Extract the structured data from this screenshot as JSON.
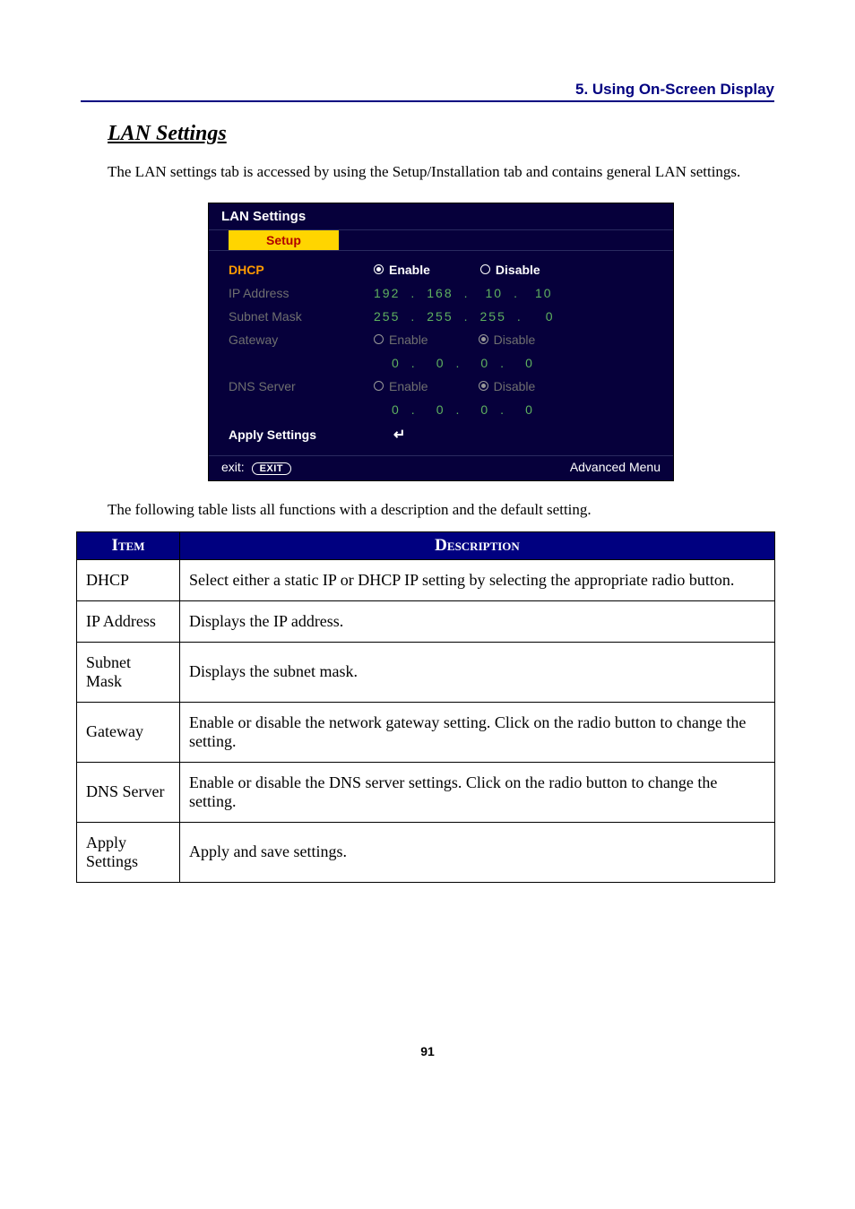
{
  "header": {
    "section": "5. Using On-Screen Display"
  },
  "subtitle": "LAN Settings",
  "intro": "The LAN settings tab is accessed by using the Setup/Installation tab and contains general LAN settings.",
  "osd": {
    "title": "LAN Settings",
    "tab": "Setup",
    "rows": {
      "dhcp": {
        "label": "DHCP",
        "enable": "Enable",
        "disable": "Disable",
        "selected": "enable",
        "active": true
      },
      "ip": {
        "label": "IP Address",
        "o1": "192",
        "o2": "168",
        "o3": "10",
        "o4": "10"
      },
      "subnet": {
        "label": "Subnet Mask",
        "o1": "255",
        "o2": "255",
        "o3": "255",
        "o4": "0"
      },
      "gateway": {
        "label": "Gateway",
        "enable": "Enable",
        "disable": "Disable",
        "selected": "disable",
        "o1": "0",
        "o2": "0",
        "o3": "0",
        "o4": "0"
      },
      "dns": {
        "label": "DNS Server",
        "enable": "Enable",
        "disable": "Disable",
        "selected": "disable",
        "o1": "0",
        "o2": "0",
        "o3": "0",
        "o4": "0"
      },
      "apply": {
        "label": "Apply Settings",
        "glyph": "↵"
      }
    },
    "footer": {
      "exit_label": "exit:",
      "exit_button": "EXIT",
      "advanced": "Advanced Menu"
    }
  },
  "table_intro": "The following table lists all functions with a description and the default setting.",
  "table": {
    "head_item": "Item",
    "head_desc": "Description",
    "rows": [
      {
        "item": "DHCP",
        "desc": "Select either a static IP or DHCP IP setting by selecting the appropriate radio button."
      },
      {
        "item": "IP Address",
        "desc": "Displays the IP address."
      },
      {
        "item": "Subnet Mask",
        "desc": "Displays the subnet mask."
      },
      {
        "item": "Gateway",
        "desc": "Enable or disable the network gateway setting. Click on the radio button to change the setting."
      },
      {
        "item": "DNS Server",
        "desc": "Enable or disable the DNS server settings. Click on the radio button to change the setting."
      },
      {
        "item": "Apply Settings",
        "desc": "Apply and save settings."
      }
    ]
  },
  "page_number": "91"
}
